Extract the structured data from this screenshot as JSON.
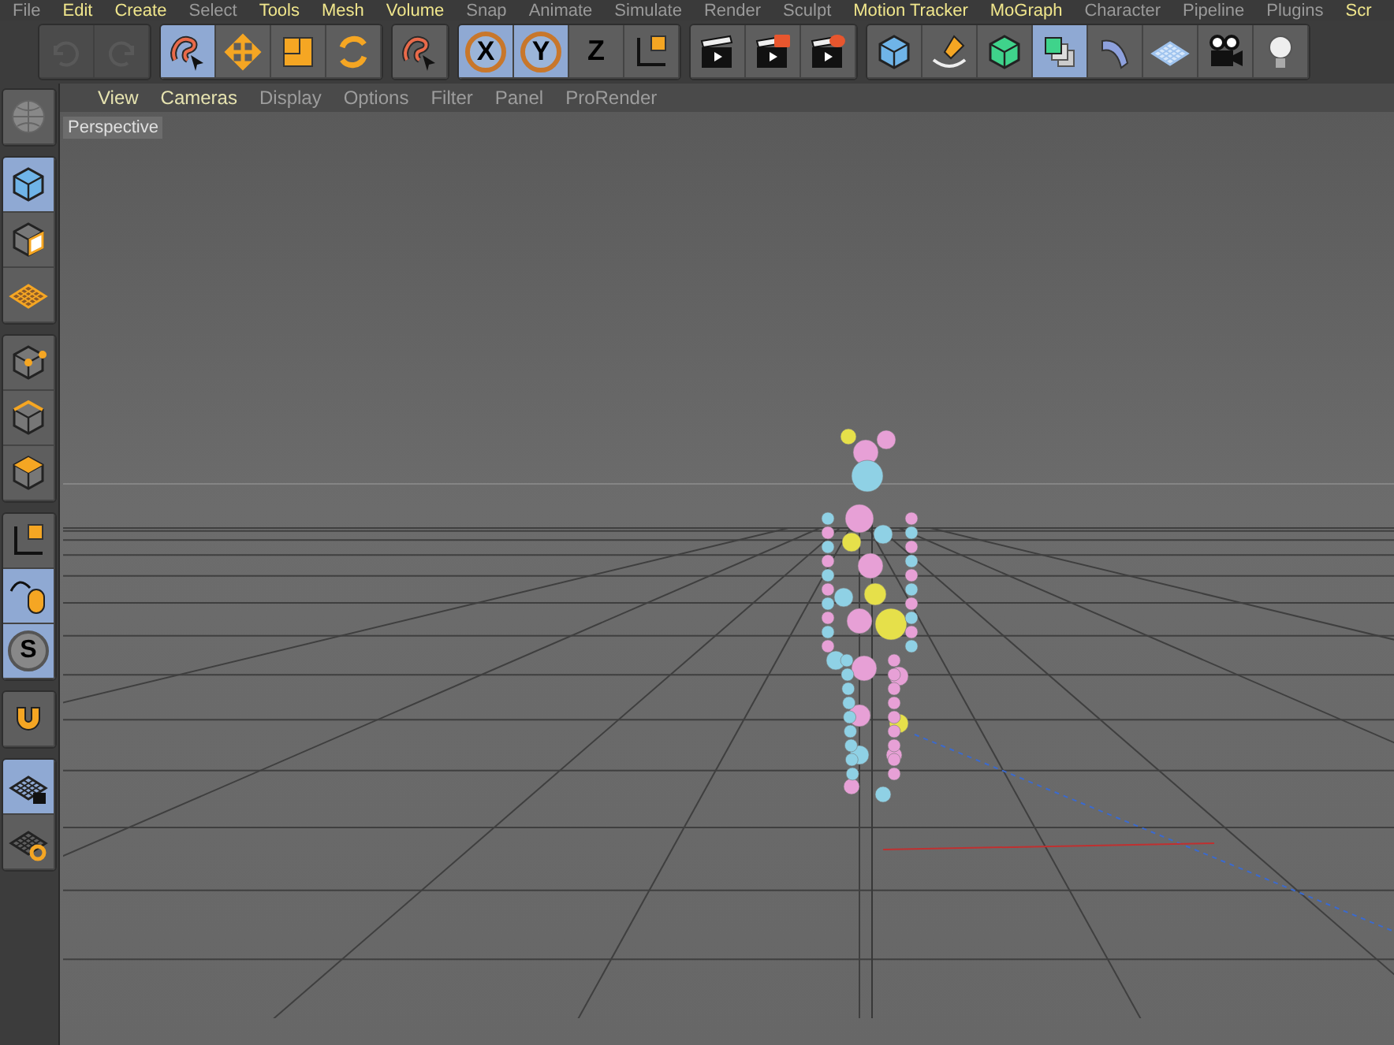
{
  "menu_bar": [
    {
      "label": "File",
      "highlighted": false
    },
    {
      "label": "Edit",
      "highlighted": true
    },
    {
      "label": "Create",
      "highlighted": true
    },
    {
      "label": "Select",
      "highlighted": false
    },
    {
      "label": "Tools",
      "highlighted": true
    },
    {
      "label": "Mesh",
      "highlighted": true
    },
    {
      "label": "Volume",
      "highlighted": true
    },
    {
      "label": "Snap",
      "highlighted": false
    },
    {
      "label": "Animate",
      "highlighted": false
    },
    {
      "label": "Simulate",
      "highlighted": false
    },
    {
      "label": "Render",
      "highlighted": false
    },
    {
      "label": "Sculpt",
      "highlighted": false
    },
    {
      "label": "Motion Tracker",
      "highlighted": true
    },
    {
      "label": "MoGraph",
      "highlighted": true
    },
    {
      "label": "Character",
      "highlighted": false
    },
    {
      "label": "Pipeline",
      "highlighted": false
    },
    {
      "label": "Plugins",
      "highlighted": false
    },
    {
      "label": "Scr",
      "highlighted": true
    }
  ],
  "toolbar": [
    [
      {
        "kind": "undo",
        "disabled": true
      },
      {
        "kind": "redo",
        "disabled": true
      }
    ],
    [
      {
        "kind": "lasso",
        "selected": true,
        "disabled": false
      },
      {
        "kind": "move",
        "selected": false,
        "disabled": false
      },
      {
        "kind": "scale",
        "selected": false,
        "disabled": false
      },
      {
        "kind": "rotate",
        "selected": false,
        "disabled": false
      }
    ],
    [
      {
        "kind": "lasso",
        "selected": false,
        "disabled": false
      }
    ],
    [
      {
        "kind": "axis",
        "label": "X",
        "selected": true,
        "disabled": false
      },
      {
        "kind": "axis",
        "label": "Y",
        "selected": true,
        "disabled": false
      },
      {
        "kind": "axis-plain",
        "label": "Z",
        "selected": false,
        "disabled": false
      },
      {
        "kind": "coords",
        "selected": false,
        "disabled": false
      }
    ],
    [
      {
        "kind": "clapper",
        "selected": false,
        "disabled": false
      },
      {
        "kind": "clapper-view",
        "selected": false,
        "disabled": false
      },
      {
        "kind": "clapper-gear",
        "selected": false,
        "disabled": false
      }
    ],
    [
      {
        "kind": "cube",
        "selected": false,
        "disabled": false
      },
      {
        "kind": "pen",
        "selected": false,
        "disabled": false
      },
      {
        "kind": "green-cube",
        "selected": false,
        "disabled": false
      },
      {
        "kind": "cube-stack",
        "selected": true,
        "disabled": false
      },
      {
        "kind": "bend",
        "selected": false,
        "disabled": false
      },
      {
        "kind": "floor",
        "selected": false,
        "disabled": false
      },
      {
        "kind": "camera",
        "selected": false,
        "disabled": false
      },
      {
        "kind": "bulb",
        "selected": false,
        "disabled": false
      }
    ]
  ],
  "side_toolbar": [
    [
      {
        "kind": "globe",
        "selected": false
      }
    ],
    [
      {
        "kind": "cube",
        "selected": true
      },
      {
        "kind": "checker-cube",
        "selected": false
      },
      {
        "kind": "grid",
        "selected": false
      }
    ],
    [
      {
        "kind": "points",
        "selected": false
      },
      {
        "kind": "edges",
        "selected": false
      },
      {
        "kind": "polygons",
        "selected": false
      }
    ],
    [
      {
        "kind": "coords",
        "selected": false
      },
      {
        "kind": "mouse",
        "selected": true
      },
      {
        "kind": "solo",
        "label": "S",
        "selected": true
      }
    ],
    [
      {
        "kind": "magnet",
        "selected": false
      }
    ],
    [
      {
        "kind": "grid-lock",
        "selected": true
      },
      {
        "kind": "grid-cycle",
        "selected": false
      }
    ]
  ],
  "viewport": {
    "menu": [
      {
        "label": "View",
        "highlighted": true
      },
      {
        "label": "Cameras",
        "highlighted": true
      },
      {
        "label": "Display",
        "highlighted": false
      },
      {
        "label": "Options",
        "highlighted": false
      },
      {
        "label": "Filter",
        "highlighted": false
      },
      {
        "label": "Panel",
        "highlighted": false
      },
      {
        "label": "ProRender",
        "highlighted": false
      }
    ],
    "camera_label": "Perspective"
  }
}
